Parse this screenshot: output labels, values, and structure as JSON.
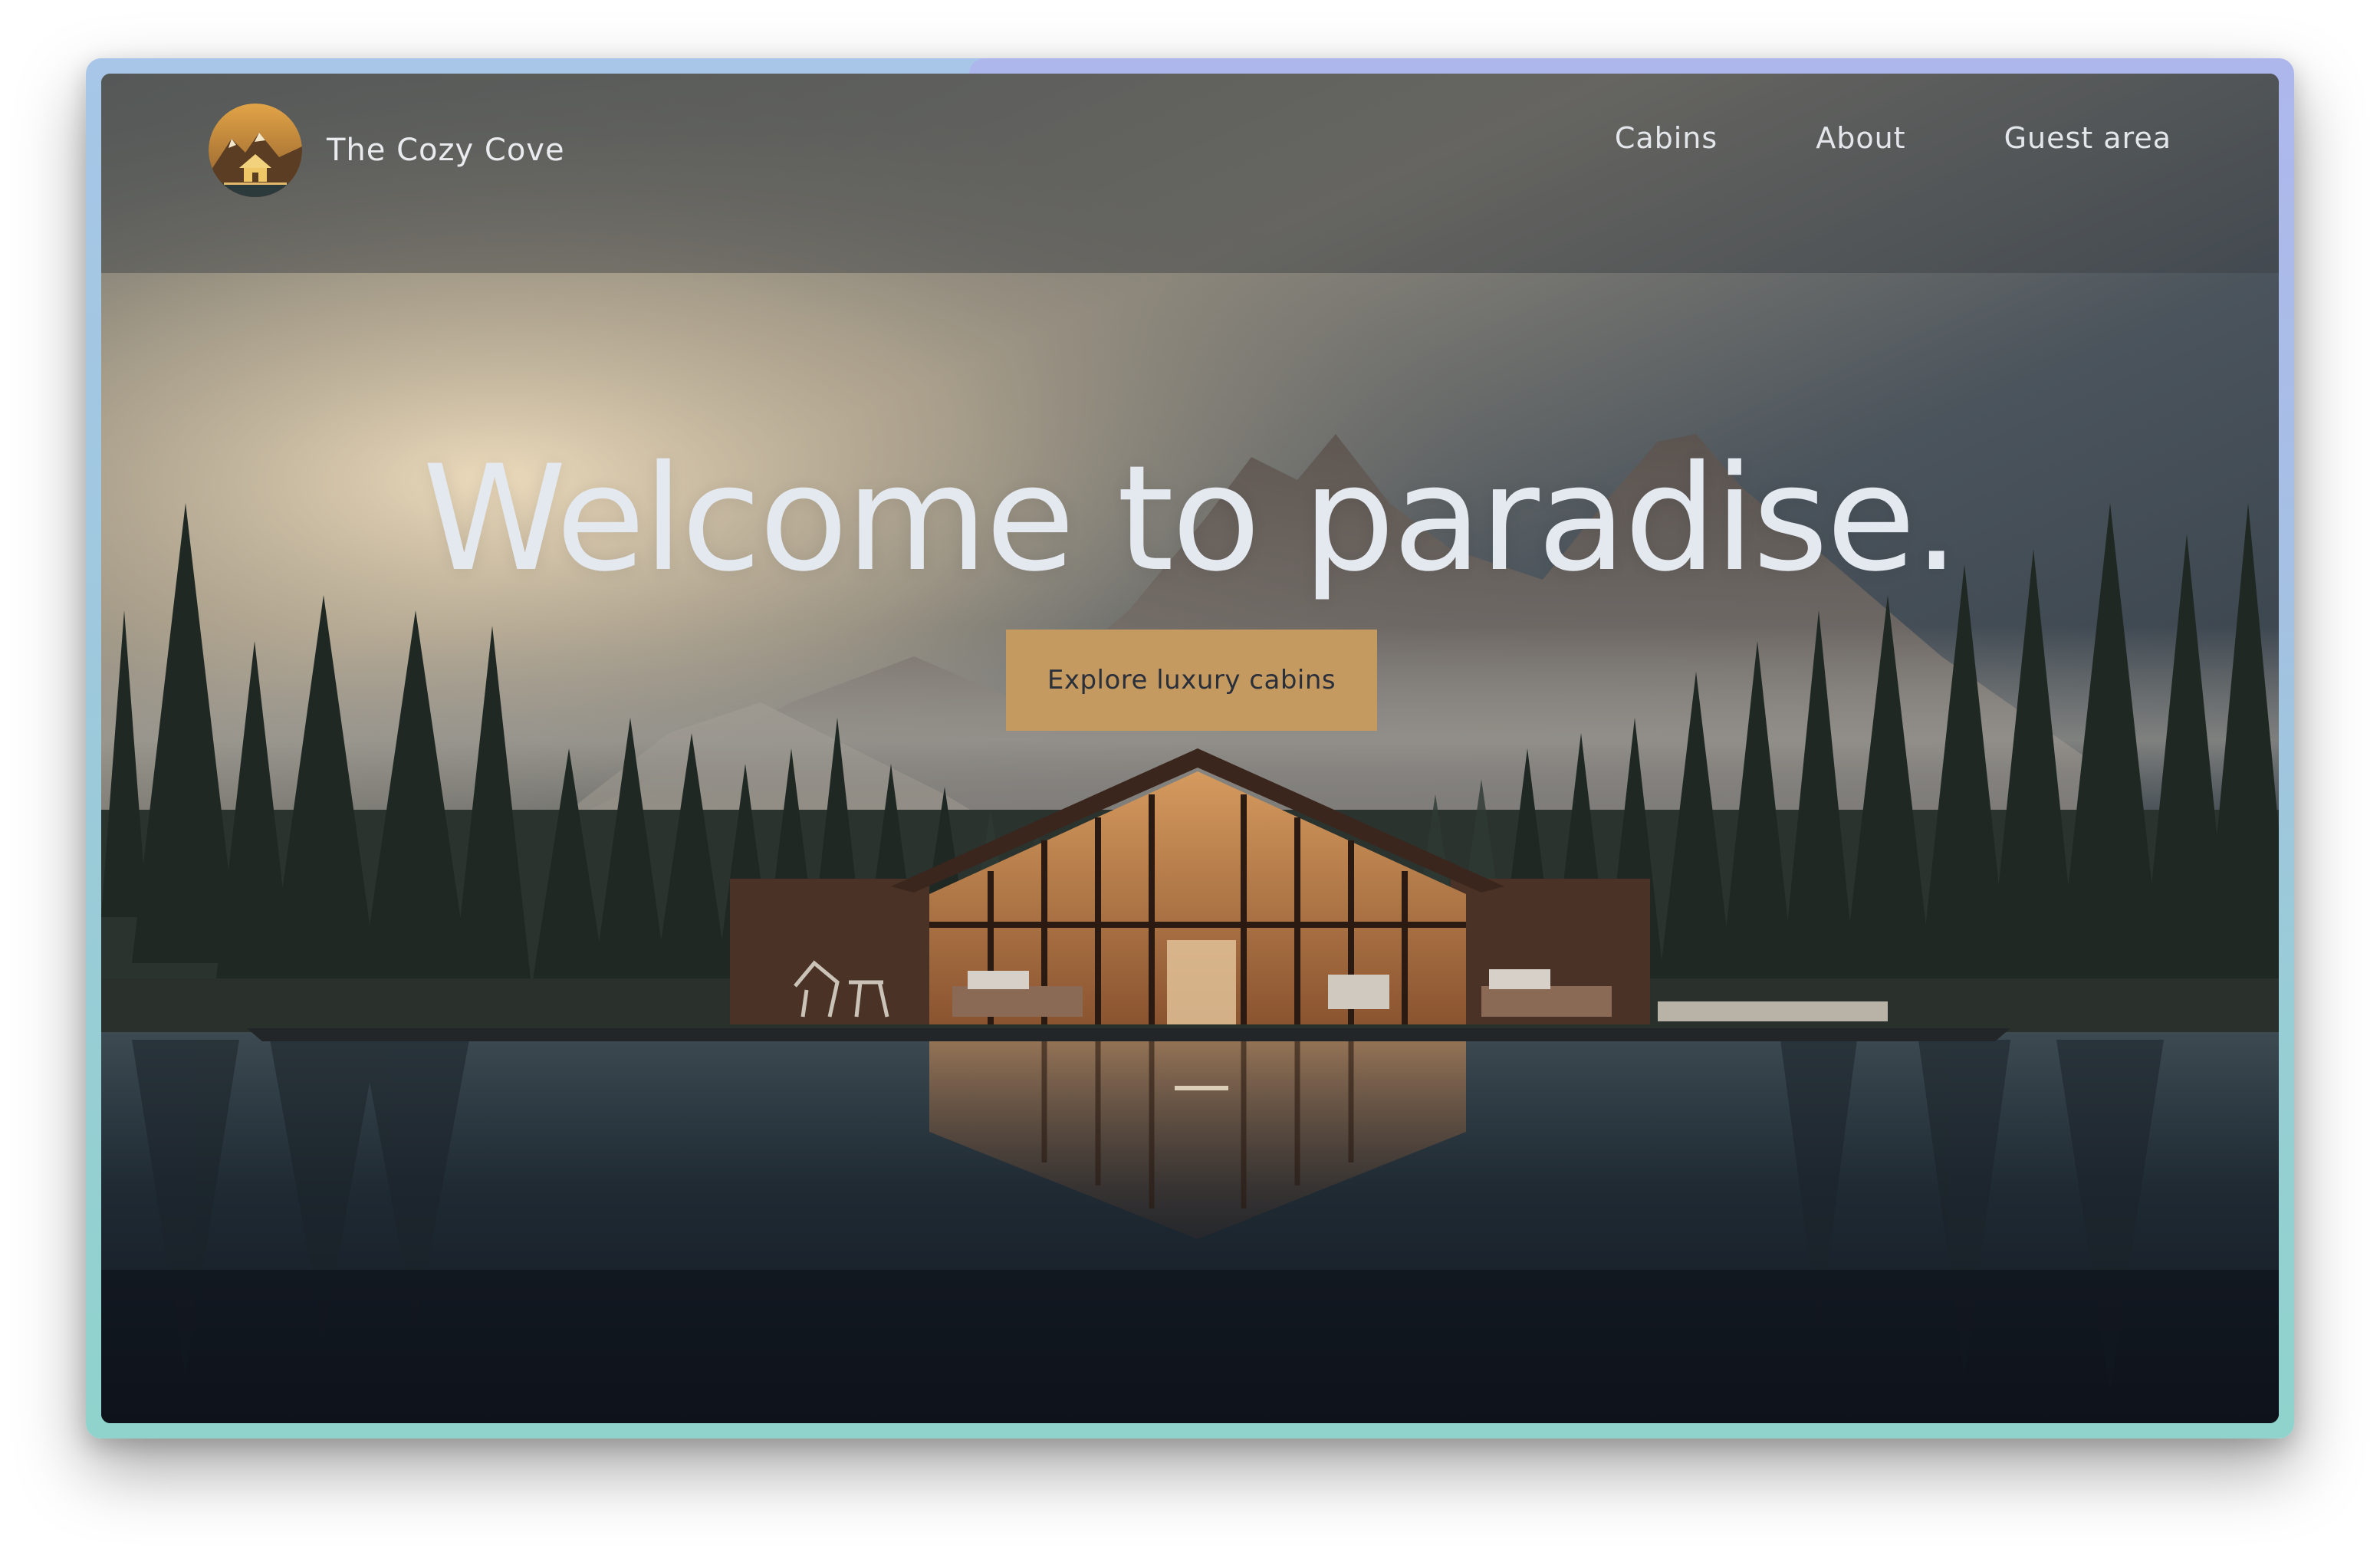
{
  "brand": {
    "name": "The Cozy Cove",
    "logo_icon": "cabin-mountain-logo-icon"
  },
  "nav": {
    "items": [
      {
        "label": "Cabins"
      },
      {
        "label": "About"
      },
      {
        "label": "Guest area"
      }
    ]
  },
  "hero": {
    "title": "Welcome to paradise.",
    "cta_label": "Explore luxury cabins",
    "background_image": "cabin-by-lake-mountains-forest-image"
  },
  "colors": {
    "cta_bg": "#c49a61",
    "cta_text": "#2a2f3a",
    "hero_text": "#e4e8ef",
    "nav_text": "#e3e6ea"
  }
}
